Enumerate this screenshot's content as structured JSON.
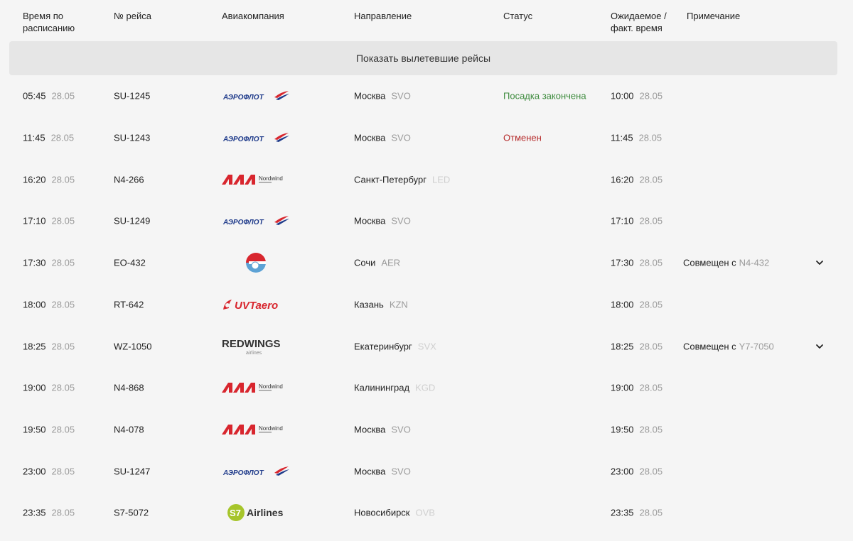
{
  "headers": {
    "scheduled": [
      "Время по",
      "расписанию"
    ],
    "flight": "№ рейса",
    "airline": "Авиакомпания",
    "direction": "Направление",
    "status": "Статус",
    "actual": [
      "Ожидаемое /",
      "факт. время"
    ],
    "note": "Примечание"
  },
  "show_departed_label": "Показать вылетевшие рейсы",
  "colors": {
    "status_green": "#3d8b3d",
    "status_red": "#b52a2a",
    "aeroflot_red": "#d8262e",
    "aeroflot_blue": "#1e3a8a",
    "s7_green": "#a6c52b"
  },
  "flights": [
    {
      "time": "05:45",
      "date": "28.05",
      "flight": "SU-1245",
      "airline_logo": "aeroflot-logo",
      "logo_text": "АЭРОФЛОТ",
      "city": "Москва",
      "code": "SVO",
      "code_faint": false,
      "status": "Посадка закончена",
      "status_type": "green",
      "act_time": "10:00",
      "act_date": "28.05",
      "note": "",
      "note_code": ""
    },
    {
      "time": "11:45",
      "date": "28.05",
      "flight": "SU-1243",
      "airline_logo": "aeroflot-logo",
      "logo_text": "АЭРОФЛОТ",
      "city": "Москва",
      "code": "SVO",
      "code_faint": false,
      "status": "Отменен",
      "status_type": "red",
      "act_time": "11:45",
      "act_date": "28.05",
      "note": "",
      "note_code": ""
    },
    {
      "time": "16:20",
      "date": "28.05",
      "flight": "N4-266",
      "airline_logo": "nordwind-logo",
      "logo_text": "Nordwind",
      "city": "Санкт-Петербург",
      "code": "LED",
      "code_faint": true,
      "status": "",
      "status_type": "",
      "act_time": "16:20",
      "act_date": "28.05",
      "note": "",
      "note_code": ""
    },
    {
      "time": "17:10",
      "date": "28.05",
      "flight": "SU-1249",
      "airline_logo": "aeroflot-logo",
      "logo_text": "АЭРОФЛОТ",
      "city": "Москва",
      "code": "SVO",
      "code_faint": false,
      "status": "",
      "status_type": "",
      "act_time": "17:10",
      "act_date": "28.05",
      "note": "",
      "note_code": ""
    },
    {
      "time": "17:30",
      "date": "28.05",
      "flight": "EO-432",
      "airline_logo": "ikar-logo",
      "logo_text": "",
      "city": "Сочи",
      "code": "AER",
      "code_faint": false,
      "status": "",
      "status_type": "",
      "act_time": "17:30",
      "act_date": "28.05",
      "note": "Совмещен с",
      "note_code": "N4-432"
    },
    {
      "time": "18:00",
      "date": "28.05",
      "flight": "RT-642",
      "airline_logo": "uvtaero-logo",
      "logo_text": "UVTaero",
      "city": "Казань",
      "code": "KZN",
      "code_faint": false,
      "status": "",
      "status_type": "",
      "act_time": "18:00",
      "act_date": "28.05",
      "note": "",
      "note_code": ""
    },
    {
      "time": "18:25",
      "date": "28.05",
      "flight": "WZ-1050",
      "airline_logo": "redwings-logo",
      "logo_text": "REDWINGS",
      "city": "Екатеринбург",
      "code": "SVX",
      "code_faint": true,
      "status": "",
      "status_type": "",
      "act_time": "18:25",
      "act_date": "28.05",
      "note": "Совмещен с",
      "note_code": "Y7-7050"
    },
    {
      "time": "19:00",
      "date": "28.05",
      "flight": "N4-868",
      "airline_logo": "nordwind-logo",
      "logo_text": "Nordwind",
      "city": "Калининград",
      "code": "KGD",
      "code_faint": true,
      "status": "",
      "status_type": "",
      "act_time": "19:00",
      "act_date": "28.05",
      "note": "",
      "note_code": ""
    },
    {
      "time": "19:50",
      "date": "28.05",
      "flight": "N4-078",
      "airline_logo": "nordwind-logo",
      "logo_text": "Nordwind",
      "city": "Москва",
      "code": "SVO",
      "code_faint": false,
      "status": "",
      "status_type": "",
      "act_time": "19:50",
      "act_date": "28.05",
      "note": "",
      "note_code": ""
    },
    {
      "time": "23:00",
      "date": "28.05",
      "flight": "SU-1247",
      "airline_logo": "aeroflot-logo",
      "logo_text": "АЭРОФЛОТ",
      "city": "Москва",
      "code": "SVO",
      "code_faint": false,
      "status": "",
      "status_type": "",
      "act_time": "23:00",
      "act_date": "28.05",
      "note": "",
      "note_code": ""
    },
    {
      "time": "23:35",
      "date": "28.05",
      "flight": "S7-5072",
      "airline_logo": "s7-logo",
      "logo_text": "Airlines",
      "city": "Новосибирск",
      "code": "OVB",
      "code_faint": true,
      "status": "",
      "status_type": "",
      "act_time": "23:35",
      "act_date": "28.05",
      "note": "",
      "note_code": ""
    }
  ]
}
